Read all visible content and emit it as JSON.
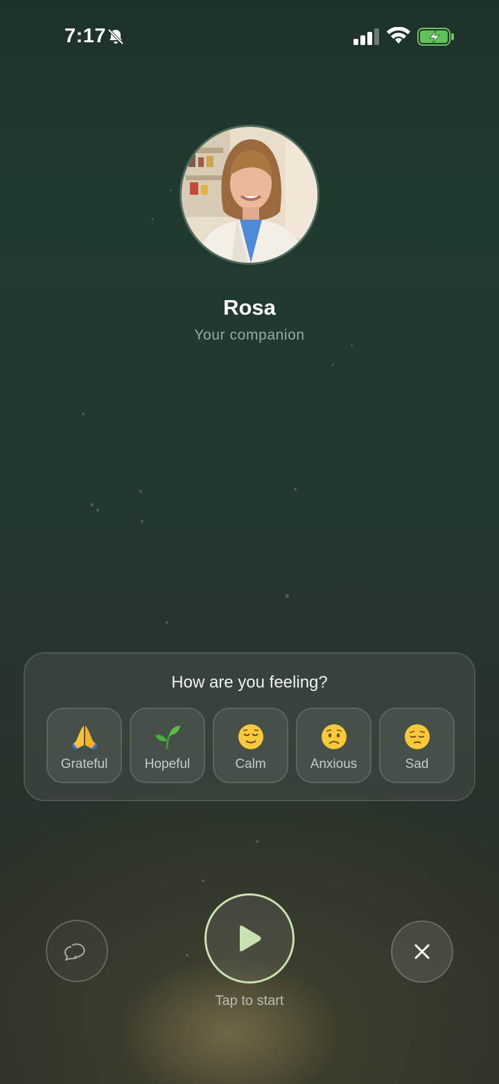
{
  "status_bar": {
    "time": "7:17",
    "silent_icon": "bell-slash-icon",
    "battery_charging": true
  },
  "companion": {
    "name": "Rosa",
    "subtitle": "Your companion"
  },
  "mood": {
    "question": "How are you feeling?",
    "options": [
      {
        "label": "Grateful",
        "icon": "folded-hands-icon"
      },
      {
        "label": "Hopeful",
        "icon": "seedling-icon"
      },
      {
        "label": "Calm",
        "icon": "relieved-face-icon"
      },
      {
        "label": "Anxious",
        "icon": "worried-face-icon"
      },
      {
        "label": "Sad",
        "icon": "pensive-face-icon"
      }
    ]
  },
  "controls": {
    "start_label": "Tap to start",
    "chat_icon": "chat-bubbles-icon",
    "play_icon": "play-icon",
    "close_icon": "close-icon"
  },
  "colors": {
    "accent": "#c7e3b1",
    "background_top": "#1d3329",
    "background_bottom": "#2c2e25"
  }
}
